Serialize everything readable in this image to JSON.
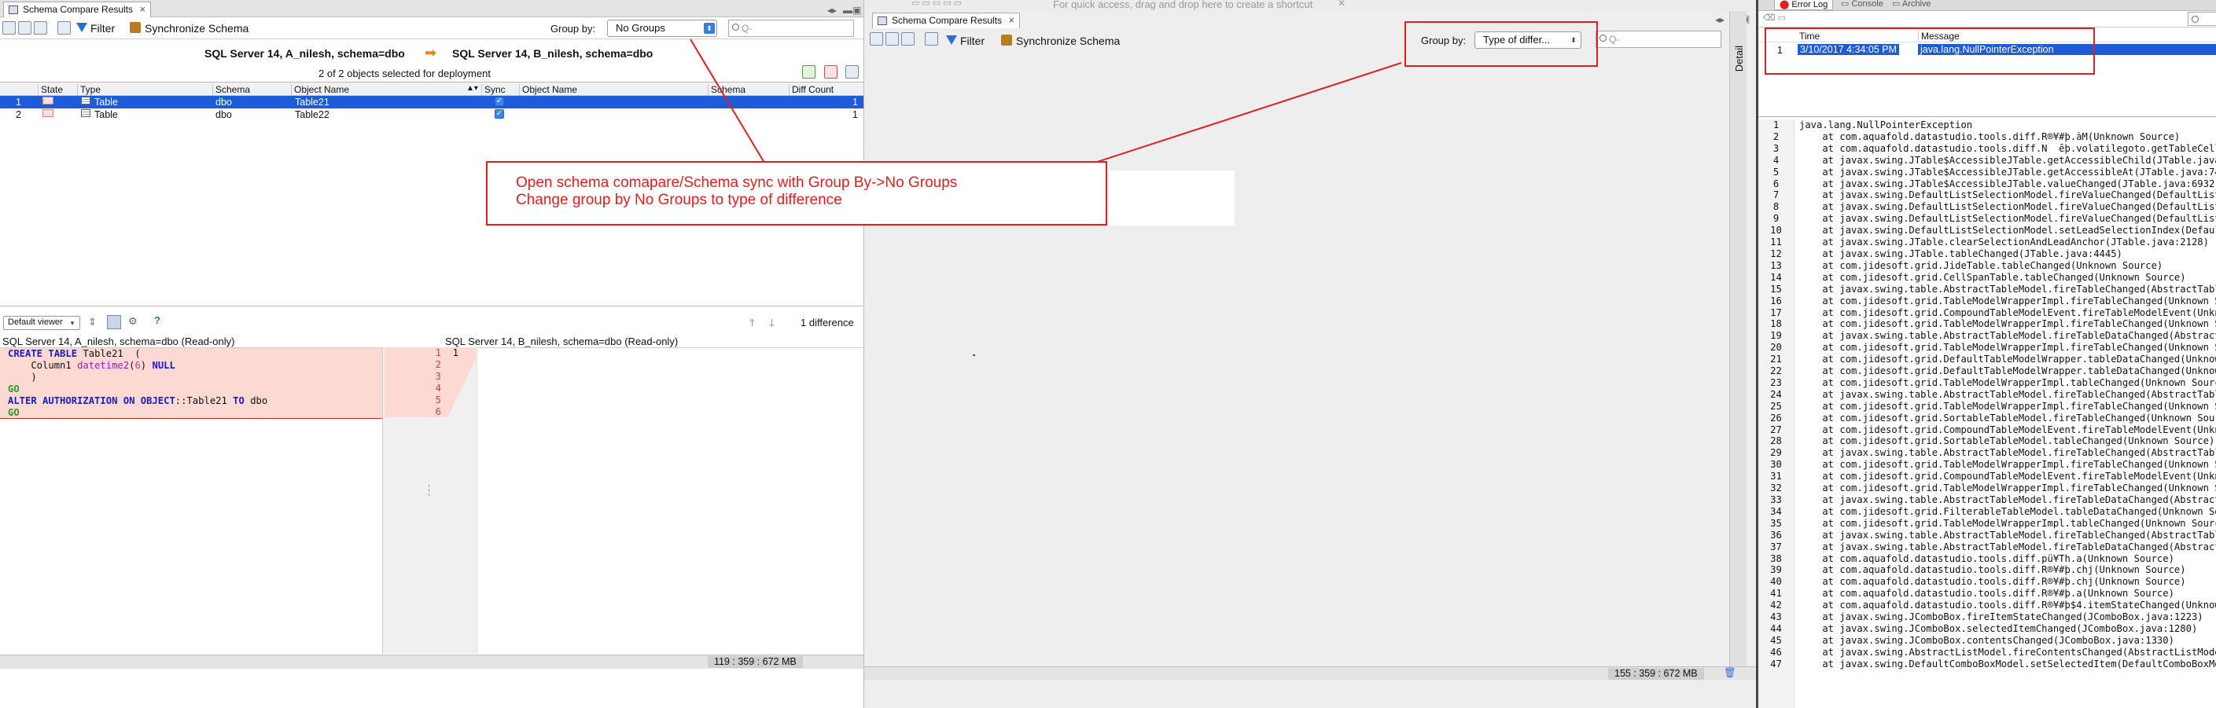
{
  "left": {
    "tab_title": "Schema Compare Results",
    "toolbar": {
      "filter_label": "Filter",
      "sync_label": "Synchronize Schema",
      "group_by_label": "Group by:",
      "group_by_value": "No Groups",
      "search_placeholder": "Q-"
    },
    "source_title": "SQL Server 14, A_nilesh,  schema=dbo",
    "target_title": "SQL Server 14, B_nilesh,  schema=dbo",
    "selection_text": "2 of 2 objects selected for deployment",
    "columns": [
      "State",
      "Type",
      "Schema",
      "Object Name",
      "Sync",
      "Object Name",
      "Schema",
      "Diff Count"
    ],
    "rows": [
      {
        "num": "1",
        "type": "Table",
        "schema": "dbo",
        "object": "Table21",
        "diff": "1"
      },
      {
        "num": "2",
        "type": "Table",
        "schema": "dbo",
        "object": "Table22",
        "diff": "1"
      }
    ],
    "viewer_select": "Default viewer",
    "diff_count_text": "1 difference",
    "left_pane_title": "SQL Server 14, A_nilesh, schema=dbo (Read-only)",
    "right_pane_title": "SQL Server 14, B_nilesh, schema=dbo (Read-only)",
    "gutter_left": [
      "1",
      "2",
      "3",
      "4",
      "5",
      "6"
    ],
    "gutter_right": [
      "1"
    ],
    "memory": "119 : 359 : 672 MB"
  },
  "annotation": {
    "line1": "Open schema comapare/Schema sync with Group By->No Groups",
    "line2": "Change group by No Groups to type of difference"
  },
  "mid": {
    "tab_title": "Schema Compare Results",
    "shortcut_hint": "For quick access, drag and drop here to create a shortcut",
    "filter_label": "Filter",
    "sync_label": "Synchronize Schema",
    "group_by_label": "Group by:",
    "group_by_value": "Type of differ...",
    "search_placeholder": "Q-",
    "side_tab": "Detail",
    "memory": "155 : 359 : 672 MB"
  },
  "right": {
    "tabs": [
      "Error Log",
      "Console",
      "Archive"
    ],
    "col_time": "Time",
    "col_message": "Message",
    "log_row": {
      "num": "1",
      "time": "3/10/2017 4:34:05 PM",
      "message": "java.lang.NullPointerException"
    },
    "trace": [
      "java.lang.NullPointerException",
      "    at com.aquafold.datastudio.tools.diff.R®¥#þ.àM(Unknown Source)",
      "    at com.aquafold.datastudio.tools.diff.N  êþ.volatilegoto.getTableCellRenderer",
      "    at javax.swing.JTable$AccessibleJTable.getAccessibleChild(JTable.java:7",
      "    at javax.swing.JTable$AccessibleJTable.getAccessibleAt(JTable.java:7418",
      "    at javax.swing.JTable$AccessibleJTable.valueChanged(JTable.java:6932)",
      "    at javax.swing.DefaultListSelectionModel.fireValueChanged(DefaultListSe",
      "    at javax.swing.DefaultListSelectionModel.fireValueChanged(DefaultListSe",
      "    at javax.swing.DefaultListSelectionModel.fireValueChanged(DefaultListSe",
      "    at javax.swing.DefaultListSelectionModel.setLeadSelectionIndex(DefaultL",
      "    at javax.swing.JTable.clearSelectionAndLeadAnchor(JTable.java:2128)",
      "    at javax.swing.JTable.tableChanged(JTable.java:4445)",
      "    at com.jidesoft.grid.JideTable.tableChanged(Unknown Source)",
      "    at com.jidesoft.grid.CellSpanTable.tableChanged(Unknown Source)",
      "    at javax.swing.table.AbstractTableModel.fireTableChanged(AbstractTableM",
      "    at com.jidesoft.grid.TableModelWrapperImpl.fireTableChanged(Unknown Sou",
      "    at com.jidesoft.grid.CompoundTableModelEvent.fireTableModelEvent(Unknow",
      "    at com.jidesoft.grid.TableModelWrapperImpl.fireTableChanged(Unknown Sou",
      "    at javax.swing.table.AbstractTableModel.fireTableDataChanged(AbstractTa",
      "    at com.jidesoft.grid.TableModelWrapperImpl.fireTableChanged(Unknown Sou",
      "    at com.jidesoft.grid.DefaultTableModelWrapper.tableDataChanged(Unknown",
      "    at com.jidesoft.grid.DefaultTableModelWrapper.tableDataChanged(Unknown",
      "    at com.jidesoft.grid.TableModelWrapperImpl.tableChanged(Unknown Source)",
      "    at javax.swing.table.AbstractTableModel.fireTableChanged(AbstractTableM",
      "    at com.jidesoft.grid.TableModelWrapperImpl.fireTableChanged(Unknown Sou",
      "    at com.jidesoft.grid.SortableTableModel.fireTableChanged(Unknown Source",
      "    at com.jidesoft.grid.CompoundTableModelEvent.fireTableModelEvent(Unknow",
      "    at com.jidesoft.grid.SortableTableModel.tableChanged(Unknown Source)",
      "    at javax.swing.table.AbstractTableModel.fireTableChanged(AbstractTableM",
      "    at com.jidesoft.grid.TableModelWrapperImpl.fireTableChanged(Unknown Sou",
      "    at com.jidesoft.grid.CompoundTableModelEvent.fireTableModelEvent(Unknow",
      "    at com.jidesoft.grid.TableModelWrapperImpl.fireTableChanged(Unknown Sou",
      "    at javax.swing.table.AbstractTableModel.fireTableDataChanged(AbstractTa",
      "    at com.jidesoft.grid.FilterableTableModel.tableDataChanged(Unknown Sour",
      "    at com.jidesoft.grid.TableModelWrapperImpl.tableChanged(Unknown Source)",
      "    at javax.swing.table.AbstractTableModel.fireTableChanged(AbstractTableM",
      "    at javax.swing.table.AbstractTableModel.fireTableDataChanged(AbstractTa",
      "    at com.aquafold.datastudio.tools.diff.pü¥Th.a(Unknown Source)",
      "    at com.aquafold.datastudio.tools.diff.R®¥#þ.chj(Unknown Source)",
      "    at com.aquafold.datastudio.tools.diff.R®¥#þ.chj(Unknown Source)",
      "    at com.aquafold.datastudio.tools.diff.R®¥#þ.a(Unknown Source)",
      "    at com.aquafold.datastudio.tools.diff.R®¥#þ$4.itemStateChanged(Unknown",
      "    at javax.swing.JComboBox.fireItemStateChanged(JComboBox.java:1223)",
      "    at javax.swing.JComboBox.selectedItemChanged(JComboBox.java:1280)",
      "    at javax.swing.JComboBox.contentsChanged(JComboBox.java:1330)",
      "    at javax.swing.AbstractListModel.fireContentsChanged(AbstractListModel.",
      "    at javax.swing.DefaultComboBoxModel.setSelectedItem(DefaultComboBoxMode"
    ]
  },
  "colors": {
    "annotation_red": "#e02020",
    "selection_blue": "#1e5bd6",
    "diff_pink": "#fcd9d3"
  }
}
